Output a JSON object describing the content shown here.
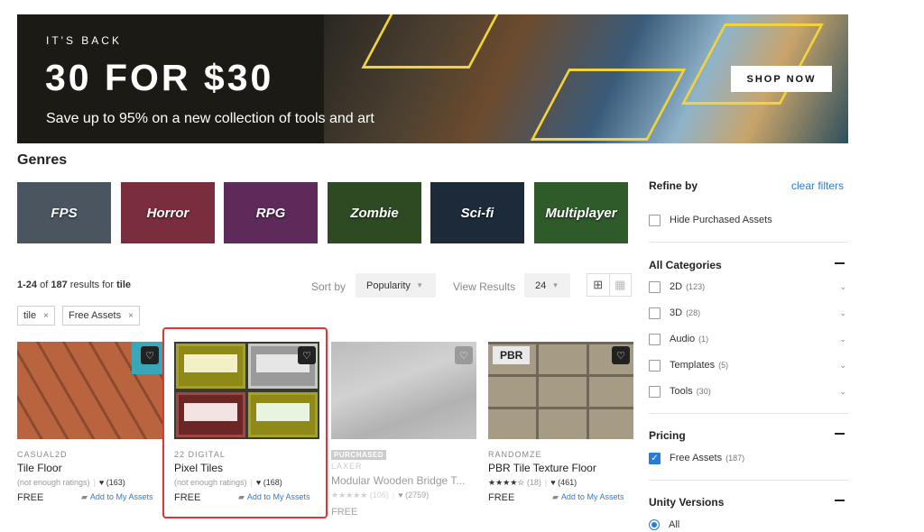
{
  "banner": {
    "eyebrow": "IT'S BACK",
    "headline": "30 FOR $30",
    "subtitle": "Save up to 95% on a new collection of tools and art",
    "cta": "SHOP NOW"
  },
  "genres": {
    "title": "Genres",
    "items": [
      {
        "label": "FPS",
        "color": "#4b5560"
      },
      {
        "label": "Horror",
        "color": "#7a2d3c"
      },
      {
        "label": "RPG",
        "color": "#5e2a5a"
      },
      {
        "label": "Zombie",
        "color": "#2d4a22"
      },
      {
        "label": "Sci-fi",
        "color": "#1d2a3a"
      },
      {
        "label": "Multiplayer",
        "color": "#2f5a2a"
      }
    ]
  },
  "results": {
    "range": "1-24",
    "of": "of",
    "total": "187",
    "for_text": "results for",
    "query": "tile",
    "sort_label": "Sort by",
    "sort_value": "Popularity",
    "view_label": "View Results",
    "view_value": "24"
  },
  "chips": [
    {
      "label": "tile",
      "close": "×"
    },
    {
      "label": "Free Assets",
      "close": "×"
    }
  ],
  "cards": [
    {
      "publisher": "CASUAL2D",
      "title": "Tile Floor",
      "ratings": "(not enough ratings)",
      "likes": "(163)",
      "price": "FREE",
      "add": "Add to My Assets"
    },
    {
      "publisher": "22 DIGITAL",
      "title": "Pixel Tiles",
      "ratings": "(not enough ratings)",
      "likes": "(168)",
      "price": "FREE",
      "add": "Add to My Assets"
    },
    {
      "badge": "PURCHASED",
      "publisher": "LAXER",
      "title": "Modular Wooden Bridge T...",
      "stars": "★★★★★",
      "rating_count": "(106)",
      "likes": "(2759)",
      "price": "FREE"
    },
    {
      "badge": "PBR",
      "publisher": "RANDOMZE",
      "title": "PBR Tile Texture Floor",
      "stars": "★★★★☆",
      "rating_count": "(18)",
      "likes": "(461)",
      "price": "FREE",
      "add": "Add to My Assets"
    }
  ],
  "sidebar": {
    "refine_by": "Refine by",
    "clear_filters": "clear filters",
    "hide_purchased": "Hide Purchased Assets",
    "categories_title": "All Categories",
    "categories": [
      {
        "label": "2D",
        "count": "(123)"
      },
      {
        "label": "3D",
        "count": "(28)"
      },
      {
        "label": "Audio",
        "count": "(1)"
      },
      {
        "label": "Templates",
        "count": "(5)"
      },
      {
        "label": "Tools",
        "count": "(30)"
      }
    ],
    "pricing_title": "Pricing",
    "pricing": {
      "label": "Free Assets",
      "count": "(187)",
      "checked": true
    },
    "unity_title": "Unity Versions",
    "unity_all": "All"
  },
  "colors": {
    "accent": "#2a7bd5",
    "highlight": "#e53232",
    "banner_accent": "#f4d23a"
  }
}
